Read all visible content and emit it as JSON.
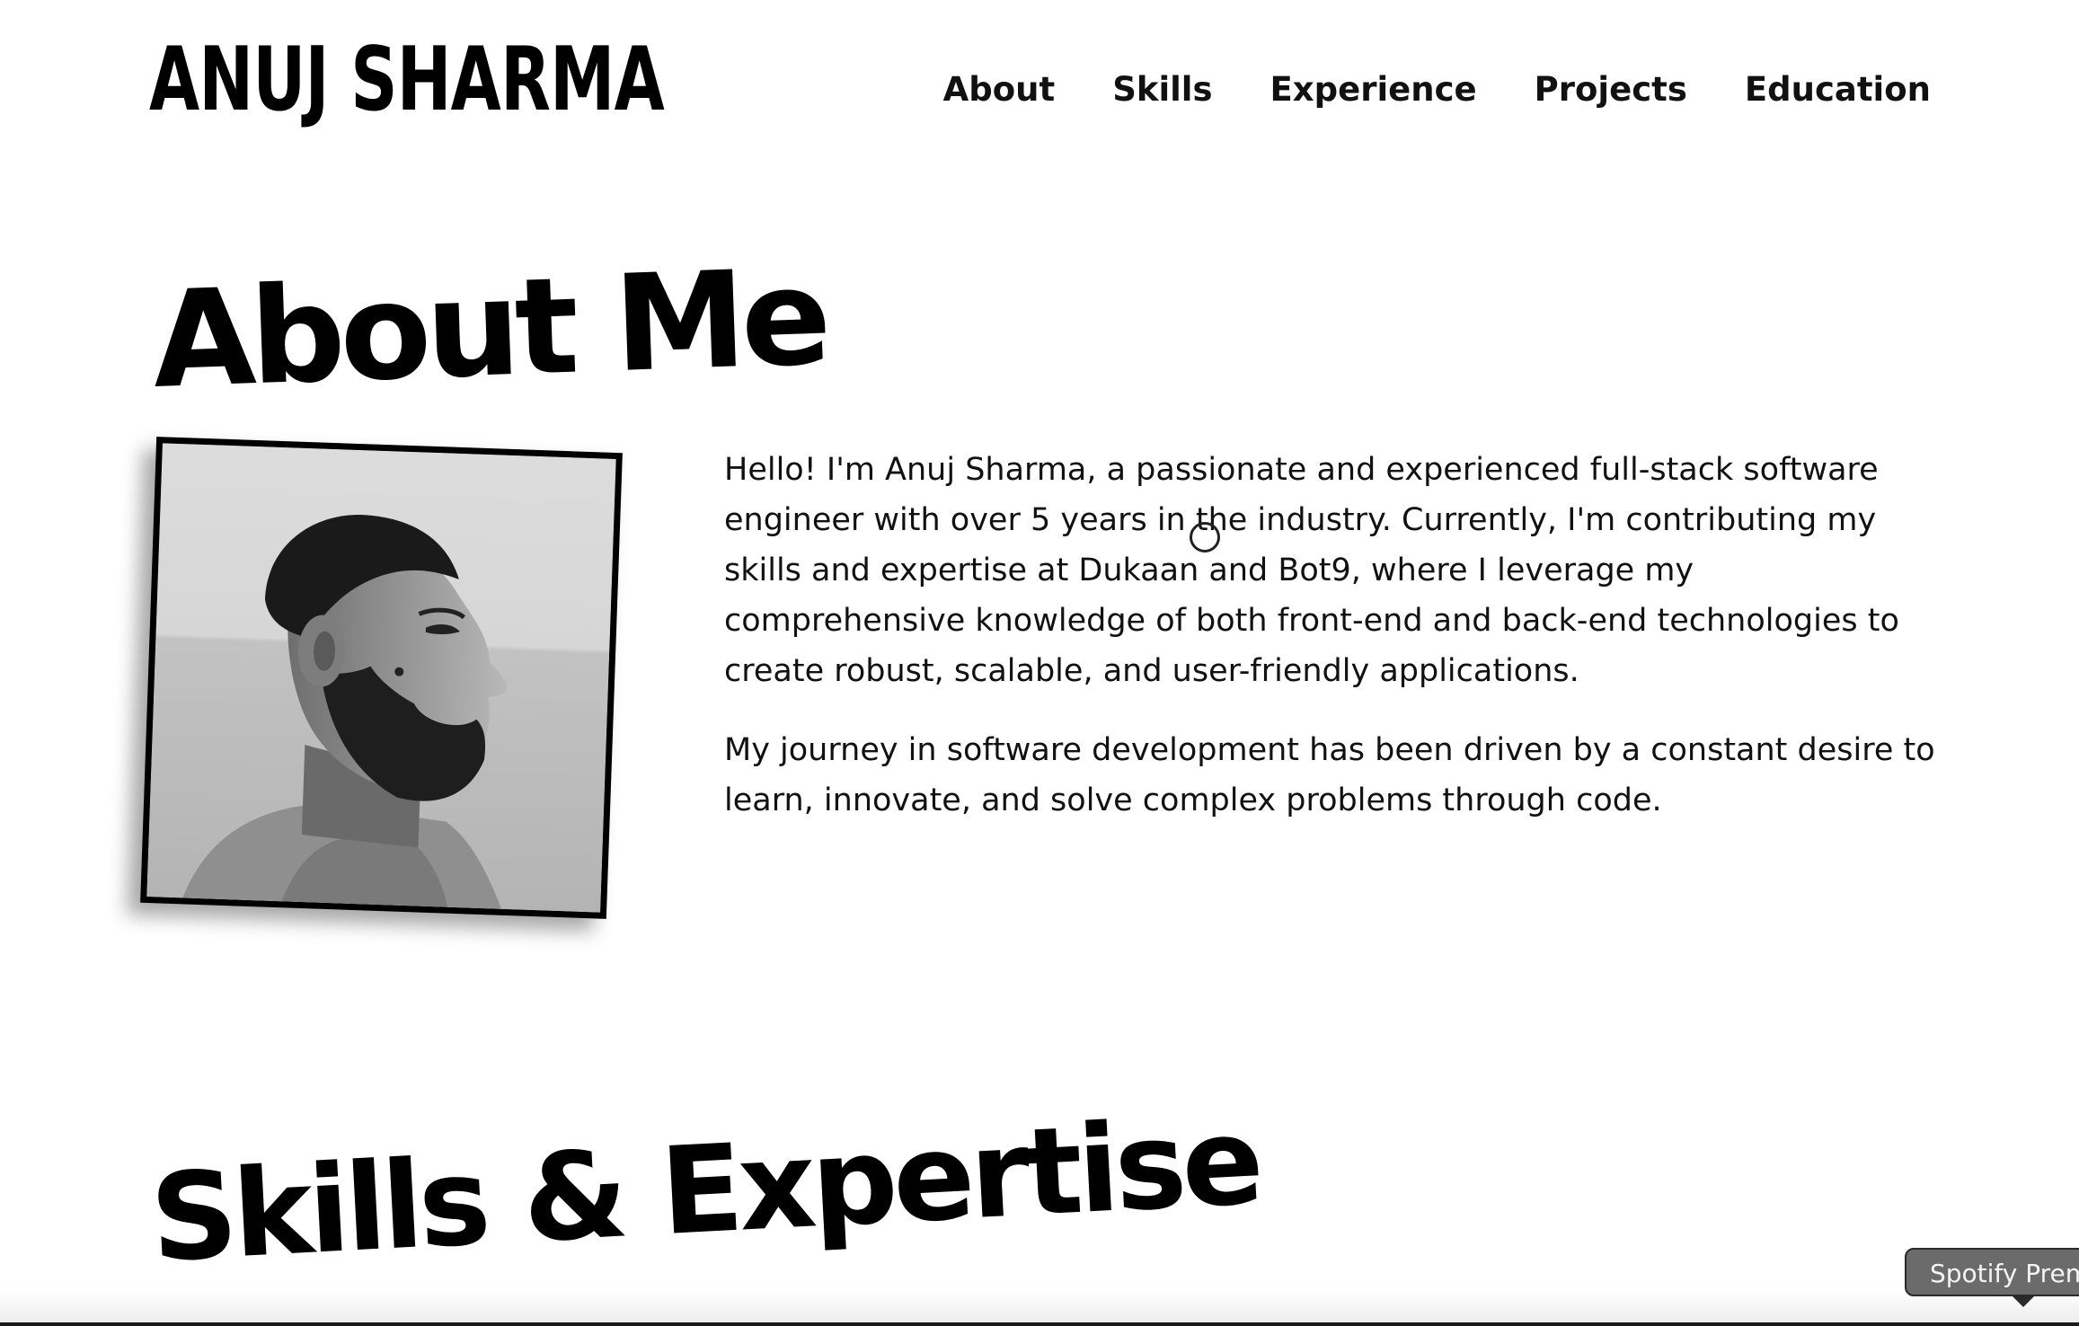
{
  "header": {
    "logo": "ANUJ SHARMA",
    "nav": [
      {
        "label": "About"
      },
      {
        "label": "Skills"
      },
      {
        "label": "Experience"
      },
      {
        "label": "Projects"
      },
      {
        "label": "Education"
      }
    ]
  },
  "about": {
    "heading": "About Me",
    "paragraphs": [
      "Hello! I'm Anuj Sharma, a passionate and experienced full-stack software engineer with over 5 years in the industry. Currently, I'm contributing my skills and expertise at Dukaan and Bot9, where I leverage my comprehensive knowledge of both front-end and back-end technologies to create robust, scalable, and user-friendly applications.",
      "My journey in software development has been driven by a constant desire to learn, innovate, and solve complex problems through code."
    ]
  },
  "skills": {
    "heading": "Skills & Expertise"
  },
  "tooltip": {
    "text": "Spotify Prem"
  }
}
